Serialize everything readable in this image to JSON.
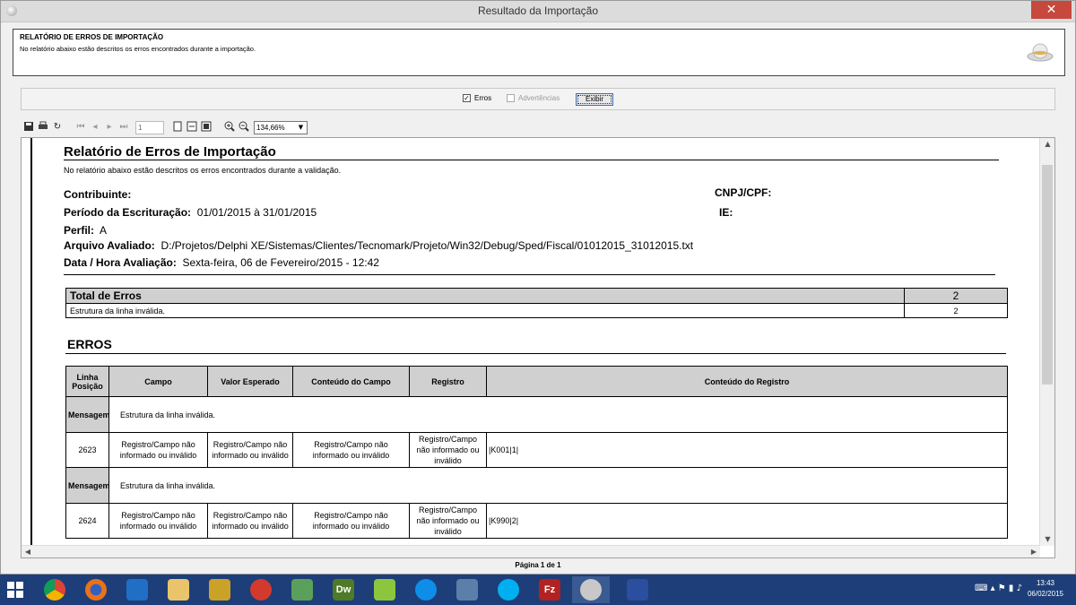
{
  "window": {
    "title": "Resultado da Importação",
    "close": "✕"
  },
  "header": {
    "title": "RELATÓRIO DE ERROS DE IMPORTAÇÃO",
    "description": "No relatório abaixo estão descritos os erros encontrados durante a importação."
  },
  "options": {
    "erros_label": "Erros",
    "erros_checked": true,
    "advertencias_label": "Advertências",
    "advertencias_checked": false,
    "exibir_label": "Exibir"
  },
  "toolbar": {
    "page_value": "1",
    "zoom_value": "134,66%"
  },
  "report": {
    "title": "Relatório de Erros de Importação",
    "subtitle": "No relatório abaixo estão descritos os erros encontrados durante a validação.",
    "contribuinte_label": "Contribuinte:",
    "cnpj_label": "CNPJ/CPF:",
    "periodo_label": "Período da Escrituração:",
    "periodo_value": "01/01/2015 à 31/01/2015",
    "ie_label": "IE:",
    "perfil_label": "Perfil:",
    "perfil_value": "A",
    "arquivo_label": "Arquivo Avaliado:",
    "arquivo_value": "D:/Projetos/Delphi XE/Sistemas/Clientes/Tecnomark/Projeto/Win32/Debug/Sped/Fiscal/01012015_31012015.txt",
    "data_label": "Data / Hora Avaliação:",
    "data_value": "Sexta-feira, 06 de Fevereiro/2015 - 12:42",
    "total_label": "Total de Erros",
    "total_value": "2",
    "total_rows": [
      {
        "label": "Estrutura da linha inválida.",
        "value": "2"
      }
    ],
    "erros_title": "ERROS",
    "columns": {
      "linha_a": "Linha",
      "linha_b": "Posição",
      "campo": "Campo",
      "valor": "Valor Esperado",
      "conteudo_campo": "Conteúdo do Campo",
      "registro": "Registro",
      "conteudo_registro": "Conteúdo do Registro"
    },
    "entries": [
      {
        "mensagem_label": "Mensagem",
        "mensagem": "Estrutura da linha inválida.",
        "linha": "2623",
        "campo": "Registro/Campo não informado ou inválido",
        "valor": "Registro/Campo não informado ou inválido",
        "conteudo_campo": "Registro/Campo não informado ou inválido",
        "registro": "Registro/Campo não informado ou inválido",
        "conteudo_registro": "|K001|1|"
      },
      {
        "mensagem_label": "Mensagem",
        "mensagem": "Estrutura da linha inválida.",
        "linha": "2624",
        "campo": "Registro/Campo não informado ou inválido",
        "valor": "Registro/Campo não informado ou inválido",
        "conteudo_campo": "Registro/Campo não informado ou inválido",
        "registro": "Registro/Campo não informado ou inválido",
        "conteudo_registro": "|K990|2|"
      }
    ]
  },
  "page_label": "Página 1 de 1",
  "taskbar": {
    "apps": [
      "chrome-icon",
      "firefox-icon",
      "outlook-icon",
      "explorer-icon",
      "delphi-icon",
      "app-red-icon",
      "app-green-icon",
      "dreamweaver-icon",
      "app-lime-icon",
      "teamviewer-icon",
      "virtualbox-icon",
      "skype-icon",
      "filezilla-icon",
      "app-gray-icon",
      "app-blue-icon"
    ],
    "dw_label": "Dw",
    "fz_label": "Fz",
    "time": "13:43",
    "date": "06/02/2015"
  }
}
